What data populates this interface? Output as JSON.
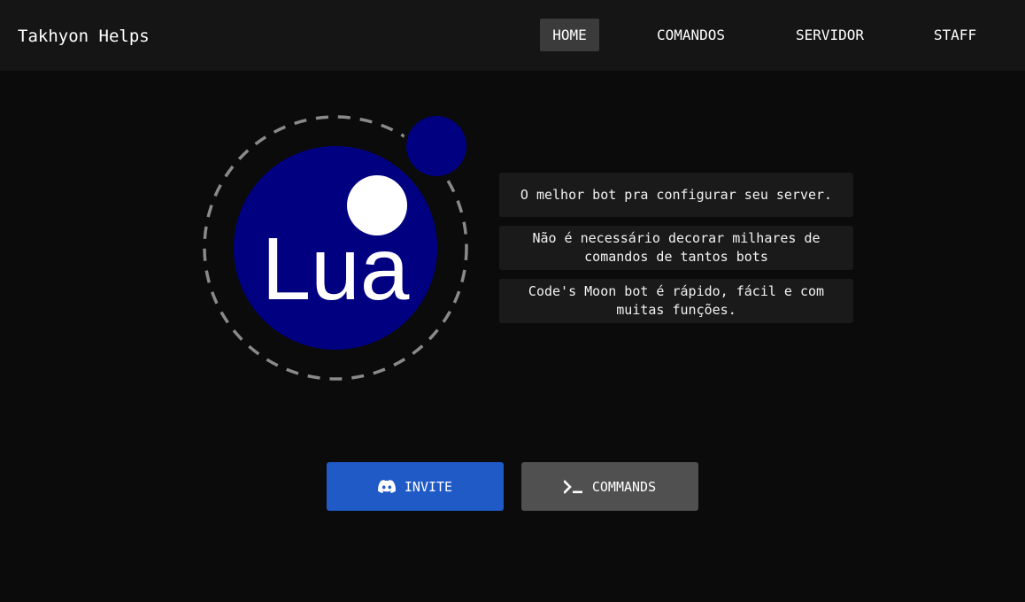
{
  "header": {
    "brand": "Takhyon Helps",
    "nav": [
      {
        "label": "HOME",
        "active": true
      },
      {
        "label": "COMANDOS",
        "active": false
      },
      {
        "label": "SERVIDOR",
        "active": false
      },
      {
        "label": "STAFF",
        "active": false
      }
    ]
  },
  "hero": {
    "logo_text": "Lua",
    "logo_colors": {
      "planet": "#000080",
      "moon": "#ffffff",
      "orbit": "#8a8a8a"
    },
    "features": [
      "O melhor bot pra configurar seu server.",
      "Não é necessário decorar milhares de comandos de tantos bots",
      "Code's Moon bot é rápido, fácil e com muitas funções."
    ]
  },
  "actions": {
    "invite": {
      "label": "INVITE",
      "icon": "discord-icon",
      "color": "#1f5ac7"
    },
    "commands": {
      "label": "COMMANDS",
      "icon": "terminal-icon",
      "color": "#505050"
    }
  }
}
